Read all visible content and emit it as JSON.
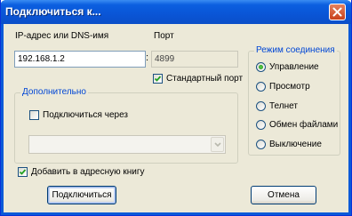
{
  "window": {
    "title": "Подключиться к...",
    "close_icon": "close-icon"
  },
  "host": {
    "label": "IP-адрес или DNS-имя",
    "value": "192.168.1.2",
    "separator": ":"
  },
  "port": {
    "label": "Порт",
    "value": "4899",
    "default_port_label": "Стандартный порт",
    "default_port_checked": true
  },
  "advanced": {
    "title": "Дополнительно",
    "connect_via_label": "Подключиться через",
    "connect_via_checked": false,
    "connect_via_value": ""
  },
  "mode": {
    "title": "Режим соединения",
    "options": [
      {
        "label": "Управление",
        "selected": true
      },
      {
        "label": "Просмотр",
        "selected": false
      },
      {
        "label": "Телнет",
        "selected": false
      },
      {
        "label": "Обмен файлами",
        "selected": false
      },
      {
        "label": "Выключение",
        "selected": false
      }
    ]
  },
  "address_book": {
    "label": "Добавить в адресную книгу",
    "checked": true
  },
  "buttons": {
    "connect": "Подключиться",
    "cancel": "Отмена"
  },
  "colors": {
    "titlebar": "#0a55d6",
    "dialog_bg": "#ece9d8",
    "group_title": "#0046d5"
  }
}
